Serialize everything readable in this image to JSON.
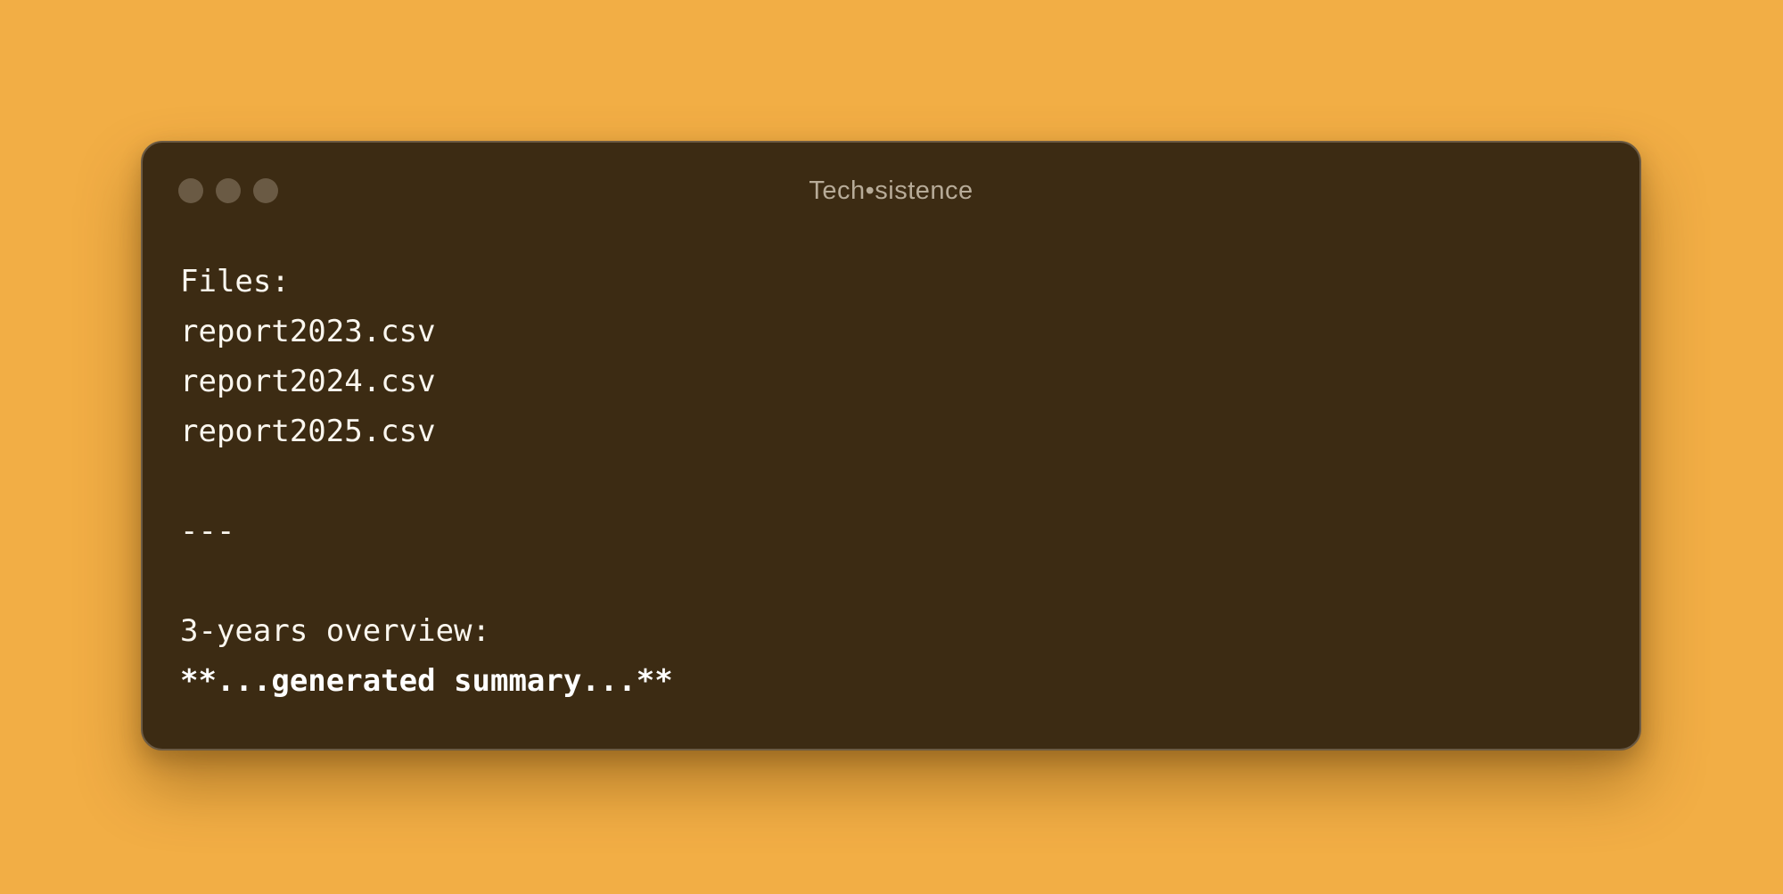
{
  "window": {
    "title": "Tech•sistence",
    "controls": [
      "close-dot",
      "minimize-dot",
      "zoom-dot"
    ]
  },
  "terminal": {
    "files_heading": "Files:",
    "files": [
      "report2023.csv",
      "report2024.csv",
      "report2025.csv"
    ],
    "separator": "---",
    "overview_heading": "3-years overview:",
    "summary": "**...generated summary...**"
  },
  "colors": {
    "background": "#f2ae45",
    "window_background": "#3c2b13",
    "window_border": "#6b5a43",
    "traffic_light_dot": "#6a5a44",
    "title_text": "#b7ab98",
    "body_text": "#fbf7ef"
  }
}
